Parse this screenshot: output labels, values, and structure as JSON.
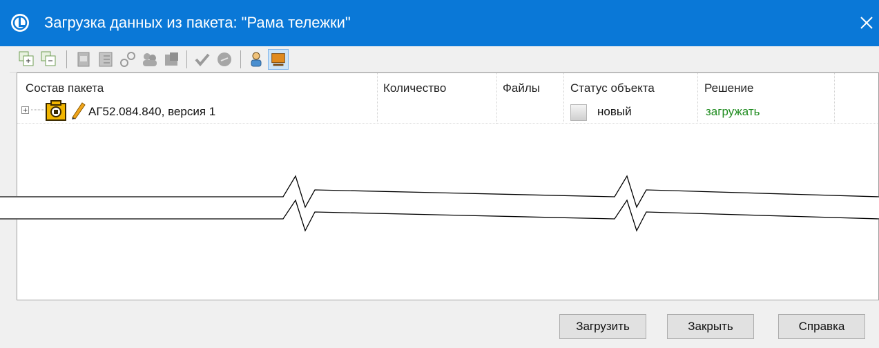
{
  "window": {
    "title": "Загрузка данных из пакета: \"Рама тележки\"",
    "accent_color": "#0a78d7"
  },
  "toolbar": {
    "buttons": [
      {
        "icon": "expand-all-icon"
      },
      {
        "icon": "collapse-all-icon"
      },
      {
        "icon": "document-icon"
      },
      {
        "icon": "list-document-icon"
      },
      {
        "icon": "link-icon"
      },
      {
        "icon": "group-icon"
      },
      {
        "icon": "stamp-icon"
      },
      {
        "icon": "check-icon"
      },
      {
        "icon": "reject-icon"
      },
      {
        "icon": "user-icon"
      },
      {
        "icon": "monitor-icon"
      }
    ]
  },
  "grid": {
    "columns": [
      "Состав пакета",
      "Количество",
      "Файлы",
      "Статус объекта",
      "Решение"
    ],
    "rows": [
      {
        "name": "АГ52.084.840, версия 1",
        "quantity": "",
        "files": "",
        "status": "новый",
        "decision": "загружать"
      }
    ]
  },
  "buttons": {
    "load": "Загрузить",
    "close": "Закрыть",
    "help": "Справка"
  }
}
